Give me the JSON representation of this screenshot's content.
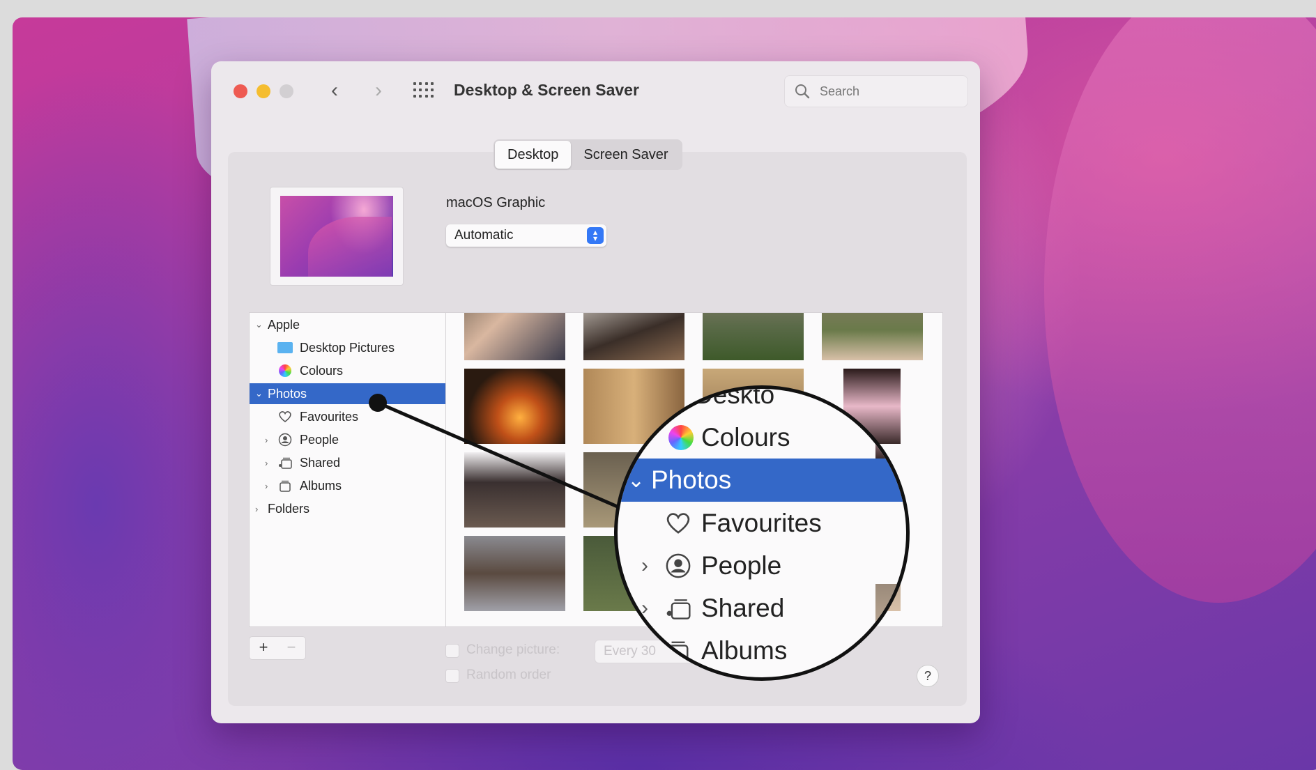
{
  "window": {
    "title": "Desktop & Screen Saver",
    "search_placeholder": "Search"
  },
  "tabs": {
    "desktop": "Desktop",
    "screen_saver": "Screen Saver",
    "active": "Desktop"
  },
  "wallpaper": {
    "name": "macOS Graphic",
    "mode": "Automatic"
  },
  "sidebar": {
    "apple": "Apple",
    "desktop_pictures": "Desktop Pictures",
    "colours": "Colours",
    "photos": "Photos",
    "favourites": "Favourites",
    "people": "People",
    "shared": "Shared",
    "albums": "Albums",
    "folders": "Folders",
    "add": "+",
    "remove": "−"
  },
  "options": {
    "change_picture": "Change picture:",
    "interval": "Every 30",
    "random_order": "Random order",
    "help": "?"
  },
  "magnifier": {
    "desktop_partial": "Deskto",
    "colours": "Colours",
    "photos": "Photos",
    "favourites": "Favourites",
    "people": "People",
    "shared": "Shared",
    "albums": "Albums"
  },
  "colors": {
    "selection": "#3468c8",
    "close": "#ee5a52",
    "minimize": "#f5bd2f",
    "accent": "#3478f6"
  }
}
